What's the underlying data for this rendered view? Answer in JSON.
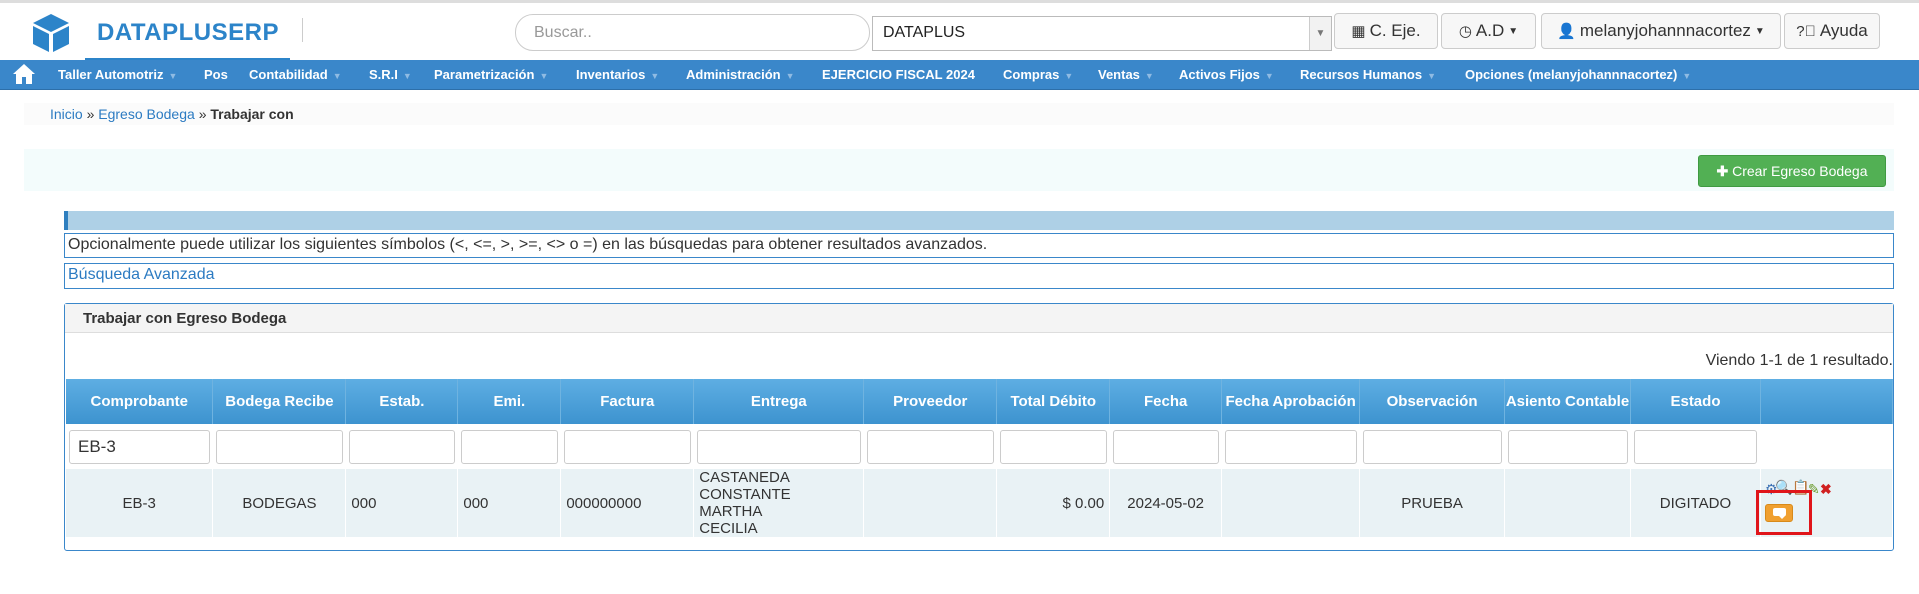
{
  "header": {
    "brand": "DATAPLUSERP",
    "search_placeholder": "Buscar..",
    "company_select": "DATAPLUS",
    "btn_cycle": "C. Eje.",
    "btn_ad": "A.D",
    "btn_user": "melanyjohannnacortez",
    "btn_help": "Ayuda"
  },
  "nav": {
    "items": [
      "Taller Automotriz",
      "Pos",
      "Contabilidad",
      "S.R.I",
      "Parametrización",
      "Inventarios",
      "Administración",
      "EJERCICIO FISCAL 2024",
      "Compras",
      "Ventas",
      "Activos Fijos",
      "Recursos Humanos",
      "Opciones (melanyjohannnacortez)"
    ]
  },
  "breadcrumb": {
    "home": "Inicio",
    "section": "Egreso Bodega",
    "sep": "»",
    "current": "Trabajar con"
  },
  "actions": {
    "create": "Crear Egreso Bodega"
  },
  "info": {
    "hint": "Opcionalmente puede utilizar los siguientes símbolos (<, <=, >, >=, <> o =) en las búsquedas para obtener resultados avanzados.",
    "advanced": "Búsqueda Avanzada"
  },
  "panel": {
    "title": "Trabajar con Egreso Bodega",
    "summary": "Viendo 1-1 de 1 resultado."
  },
  "table": {
    "columns": [
      "Comprobante",
      "Bodega Recibe",
      "Estab.",
      "Emi.",
      "Factura",
      "Entrega",
      "Proveedor",
      "Total Débito",
      "Fecha",
      "Fecha Aprobación",
      "Observación",
      "Asiento Contable",
      "Estado"
    ],
    "filters": [
      "EB-3",
      "",
      "",
      "",
      "",
      "",
      "",
      "",
      "",
      "",
      "",
      "",
      ""
    ],
    "row": {
      "comprobante": "EB-3",
      "bodega": "BODEGAS",
      "estab": "000",
      "emi": "000",
      "factura": "000000000",
      "entrega": "CASTANEDA CONSTANTE MARTHA CECILIA",
      "proveedor": "",
      "total": "$ 0.00",
      "fecha": "2024-05-02",
      "fecha_aprob": "",
      "observacion": "PRUEBA",
      "asiento": "",
      "estado": "DIGITADO"
    }
  }
}
